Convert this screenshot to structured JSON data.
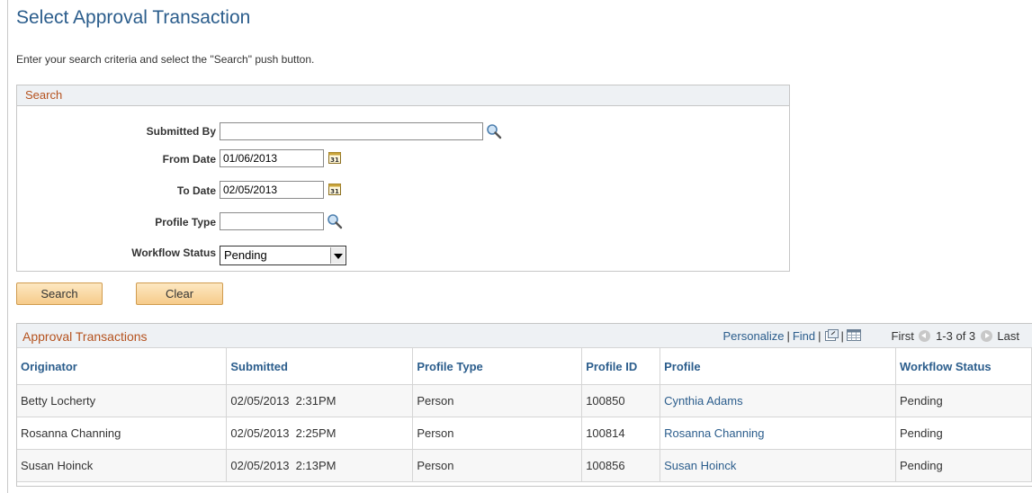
{
  "page": {
    "title": "Select Approval Transaction",
    "instructions": "Enter your search criteria and select the \"Search\" push button."
  },
  "search": {
    "header": "Search",
    "submitted_by_label": "Submitted By",
    "submitted_by_value": "",
    "from_date_label": "From Date",
    "from_date_value": "01/06/2013",
    "to_date_label": "To Date",
    "to_date_value": "02/05/2013",
    "profile_type_label": "Profile Type",
    "profile_type_value": "",
    "workflow_status_label": "Workflow Status",
    "workflow_status_value": "Pending"
  },
  "buttons": {
    "search": "Search",
    "clear": "Clear"
  },
  "grid": {
    "title": "Approval Transactions",
    "personalize": "Personalize",
    "find": "Find",
    "first": "First",
    "range": "1-3 of 3",
    "last": "Last",
    "columns": [
      "Originator",
      "Submitted",
      "Profile Type",
      "Profile ID",
      "Profile",
      "Workflow Status"
    ],
    "rows": [
      [
        "Betty Locherty",
        "02/05/2013  2:31PM",
        "Person",
        "100850",
        "Cynthia Adams",
        "Pending"
      ],
      [
        "Rosanna Channing",
        "02/05/2013  2:25PM",
        "Person",
        "100814",
        "Rosanna Channing",
        "Pending"
      ],
      [
        "Susan Hoinck",
        "02/05/2013  2:13PM",
        "Person",
        "100856",
        "Susan Hoinck",
        "Pending"
      ]
    ]
  },
  "icons": {
    "lookup": "magnifier-icon",
    "calendar": "calendar-icon",
    "zoom": "new-window-icon",
    "download": "spreadsheet-icon"
  },
  "colors": {
    "title_blue": "#2b5d8c",
    "header_orange": "#b5521e",
    "button_fill": "#f6cb8a"
  }
}
